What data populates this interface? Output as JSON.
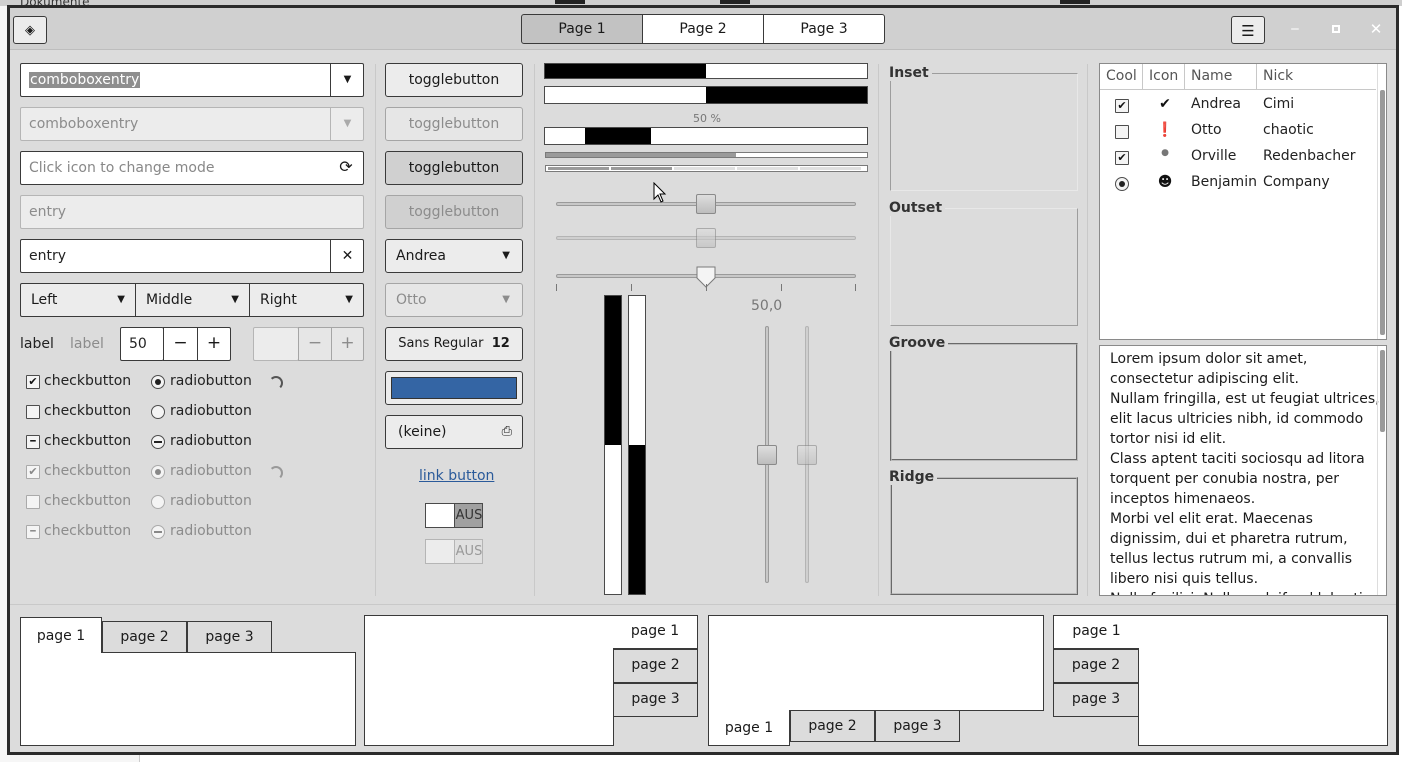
{
  "desktop": {
    "file_label": "Dokumente"
  },
  "header": {
    "tabs": [
      {
        "label": "Page 1"
      },
      {
        "label": "Page 2"
      },
      {
        "label": "Page 3"
      }
    ]
  },
  "entries": {
    "combo1": "comboboxentry",
    "combo2": "comboboxentry",
    "mode_placeholder": "Click icon to change mode",
    "entry_disabled": "entry",
    "entry_clear": "entry"
  },
  "segments": [
    {
      "label": "Left"
    },
    {
      "label": "Middle"
    },
    {
      "label": "Right"
    }
  ],
  "spin": {
    "label1": "label",
    "label2": "label",
    "value": "50"
  },
  "checks": [
    {
      "label": "checkbutton",
      "radio": "radiobutton",
      "state": "checked"
    },
    {
      "label": "checkbutton",
      "radio": "radiobutton",
      "state": "unchecked"
    },
    {
      "label": "checkbutton",
      "radio": "radiobutton",
      "state": "mixed"
    },
    {
      "label": "checkbutton",
      "radio": "radiobutton",
      "state": "checked"
    },
    {
      "label": "checkbutton",
      "radio": "radiobutton",
      "state": "unchecked"
    },
    {
      "label": "checkbutton",
      "radio": "radiobutton",
      "state": "mixed"
    }
  ],
  "toggles": [
    {
      "label": "togglebutton"
    },
    {
      "label": "togglebutton"
    },
    {
      "label": "togglebutton"
    },
    {
      "label": "togglebutton"
    }
  ],
  "combos": {
    "first": "Andrea",
    "second": "Otto"
  },
  "font_button": {
    "name": "Sans Regular",
    "size": "12"
  },
  "color_button": {
    "color": "#3465a4"
  },
  "file_button": {
    "label": "(keine)"
  },
  "link_button": {
    "label": "link button"
  },
  "switches": {
    "label1": "AUS",
    "label2": "AUS"
  },
  "progress": {
    "label": "50 %",
    "value": 0.5
  },
  "scale": {
    "value_label": "50,0",
    "value": 50
  },
  "frames": [
    {
      "label": "Inset"
    },
    {
      "label": "Outset"
    },
    {
      "label": "Groove"
    },
    {
      "label": "Ridge"
    }
  ],
  "tree": {
    "columns": [
      "Cool",
      "Icon",
      "Name",
      "Nick"
    ],
    "rows": [
      {
        "cool": "checked",
        "icon": "check-circle-icon",
        "name": "Andrea",
        "nick": "Cimi"
      },
      {
        "cool": "unchecked",
        "icon": "warning-icon",
        "name": "Otto",
        "nick": "chaotic"
      },
      {
        "cool": "checked",
        "icon": "dot-icon",
        "name": "Orville",
        "nick": "Redenbacher"
      },
      {
        "cool": "radio",
        "icon": "face-icon",
        "name": "Benjamin",
        "nick": "Company"
      }
    ]
  },
  "textview": {
    "lines": [
      "Lorem ipsum dolor sit amet,",
      "consectetur adipiscing elit.",
      "Nullam fringilla, est ut feugiat ultrices,",
      "elit lacus ultricies nibh, id commodo",
      "tortor nisi id elit.",
      "Class aptent taciti sociosqu ad litora",
      "torquent per conubia nostra, per",
      "inceptos himenaeos.",
      "Morbi vel elit erat. Maecenas",
      "dignissim, dui et pharetra rutrum,",
      "tellus lectus rutrum mi, a convallis",
      "libero nisi quis tellus.",
      "Nulla facilisi. Nullam eleifend lobortis"
    ]
  },
  "notebooks": [
    {
      "tabs": [
        "page 1",
        "page 2",
        "page 3"
      ]
    },
    {
      "tabs": [
        "page 1",
        "page 2",
        "page 3"
      ]
    },
    {
      "tabs": [
        "page 1",
        "page 2",
        "page 3"
      ]
    },
    {
      "tabs": [
        "page 1",
        "page 2",
        "page 3"
      ]
    }
  ]
}
